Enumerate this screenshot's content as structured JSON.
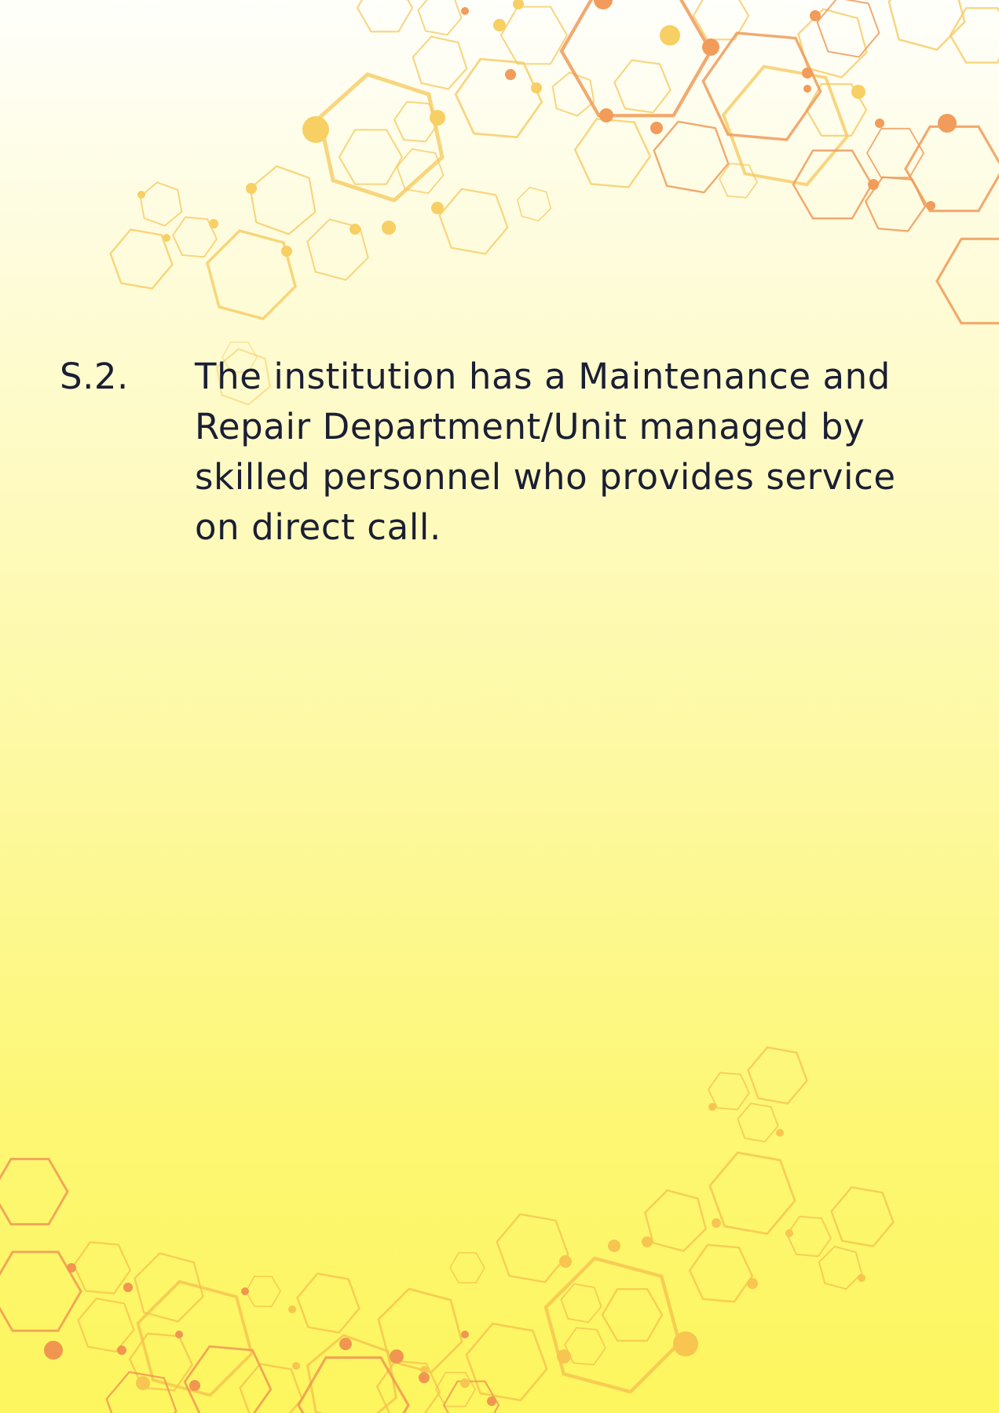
{
  "document": {
    "item_number": "S.2.",
    "item_text": "The institution has a Maintenance and Repair Department/Unit managed by skilled personnel who provides service on direct call."
  },
  "theme": {
    "background_top": "#fffffb",
    "background_bottom": "#fdf65e",
    "text_color": "#1a1f33",
    "hex_gold": "#f7cf68",
    "hex_orange": "#f1a25f"
  }
}
